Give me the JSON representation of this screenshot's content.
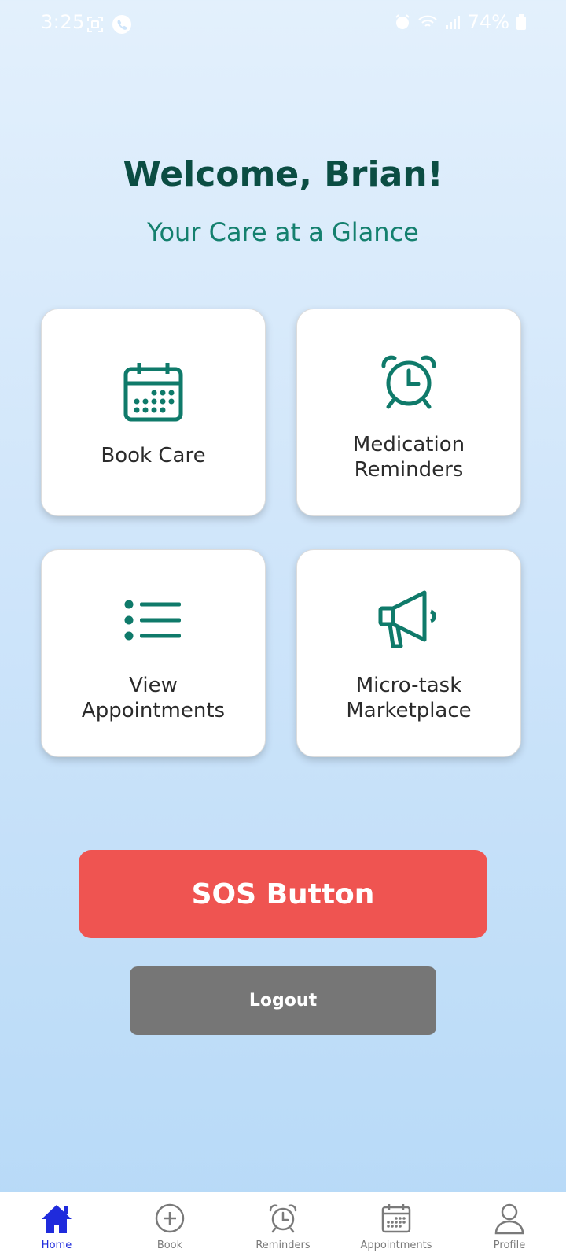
{
  "status_bar": {
    "time": "3:25",
    "battery": "74%"
  },
  "header": {
    "welcome": "Welcome, Brian!",
    "subtitle": "Your Care at a Glance"
  },
  "cards": [
    {
      "label": "Book Care",
      "icon": "calendar-icon"
    },
    {
      "label_lines": [
        "Medication",
        "Reminders"
      ],
      "icon": "alarm-clock-icon"
    },
    {
      "label_lines": [
        "View",
        "Appointments"
      ],
      "icon": "list-icon"
    },
    {
      "label_lines": [
        "Micro-task",
        "Marketplace"
      ],
      "icon": "megaphone-icon"
    }
  ],
  "buttons": {
    "sos": "SOS Button",
    "logout": "Logout"
  },
  "bottom_nav": {
    "items": [
      {
        "label": "Home",
        "icon": "home-icon",
        "active": true
      },
      {
        "label": "Book",
        "icon": "plus-circle-icon"
      },
      {
        "label": "Reminders",
        "icon": "alarm-clock-icon"
      },
      {
        "label": "Appointments",
        "icon": "calendar-icon"
      },
      {
        "label": "Profile",
        "icon": "person-icon"
      }
    ]
  },
  "colors": {
    "primary_teal": "#0f7a6a",
    "heading": "#0b4d43",
    "sos": "#ef5451",
    "logout": "#767676",
    "nav_active": "#1f2bdc"
  }
}
